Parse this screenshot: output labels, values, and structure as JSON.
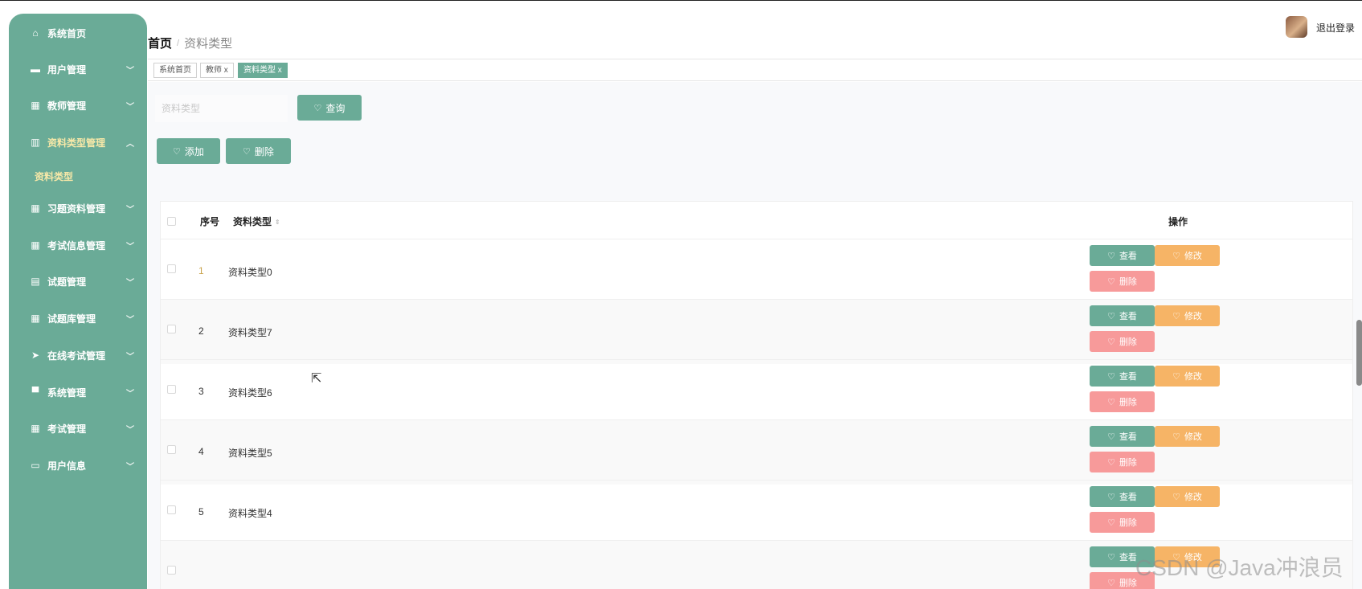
{
  "sidebar": {
    "items": [
      {
        "label": "系统首页",
        "icon": "home-icon",
        "glyph": "⌂",
        "arrow": ""
      },
      {
        "label": "用户管理",
        "icon": "user-manage-icon",
        "glyph": "▬",
        "arrow": "﹀"
      },
      {
        "label": "教师管理",
        "icon": "grid-icon",
        "glyph": "▦",
        "arrow": "﹀"
      },
      {
        "label": "资料类型管理",
        "icon": "chart-icon",
        "glyph": "▥",
        "arrow": "︿"
      },
      {
        "label": "习题资料管理",
        "icon": "grid-icon",
        "glyph": "▦",
        "arrow": "﹀"
      },
      {
        "label": "考试信息管理",
        "icon": "grid-icon",
        "glyph": "▦",
        "arrow": "﹀"
      },
      {
        "label": "试题管理",
        "icon": "clipboard-icon",
        "glyph": "▤",
        "arrow": "﹀"
      },
      {
        "label": "试题库管理",
        "icon": "grid-icon",
        "glyph": "▦",
        "arrow": "﹀"
      },
      {
        "label": "在线考试管理",
        "icon": "send-icon",
        "glyph": "➤",
        "arrow": "﹀"
      },
      {
        "label": "系统管理",
        "icon": "monitor-icon",
        "glyph": "▀",
        "arrow": "﹀"
      },
      {
        "label": "考试管理",
        "icon": "grid-icon",
        "glyph": "▦",
        "arrow": "﹀"
      },
      {
        "label": "用户信息",
        "icon": "card-icon",
        "glyph": "▭",
        "arrow": "﹀"
      }
    ],
    "submenu_label": "资料类型"
  },
  "header": {
    "breadcrumb_home": "首页",
    "breadcrumb_sep": "/",
    "breadcrumb_current": "资料类型",
    "logout": "退出登录"
  },
  "tags": [
    {
      "label": "系统首页"
    },
    {
      "label": "教师 x"
    },
    {
      "label": "资料类型 x"
    }
  ],
  "search": {
    "placeholder": "资料类型",
    "query_button": "查询"
  },
  "toolbar": {
    "add_button": "添加",
    "delete_button": "删除"
  },
  "table": {
    "columns": {
      "index": "序号",
      "type": "资料类型",
      "actions": "操作"
    },
    "rows": [
      {
        "index": "1",
        "type": "资料类型0"
      },
      {
        "index": "2",
        "type": "资料类型7"
      },
      {
        "index": "3",
        "type": "资料类型6"
      },
      {
        "index": "4",
        "type": "资料类型5"
      },
      {
        "index": "5",
        "type": "资料类型4"
      },
      {
        "index": "",
        "type": ""
      }
    ],
    "actions": {
      "view": "查看",
      "edit": "修改",
      "delete": "删除"
    }
  },
  "watermark": "CSDN @Java冲浪员",
  "colors": {
    "primary": "#6aab97",
    "warning": "#f6b466",
    "danger": "#f79a9a"
  }
}
